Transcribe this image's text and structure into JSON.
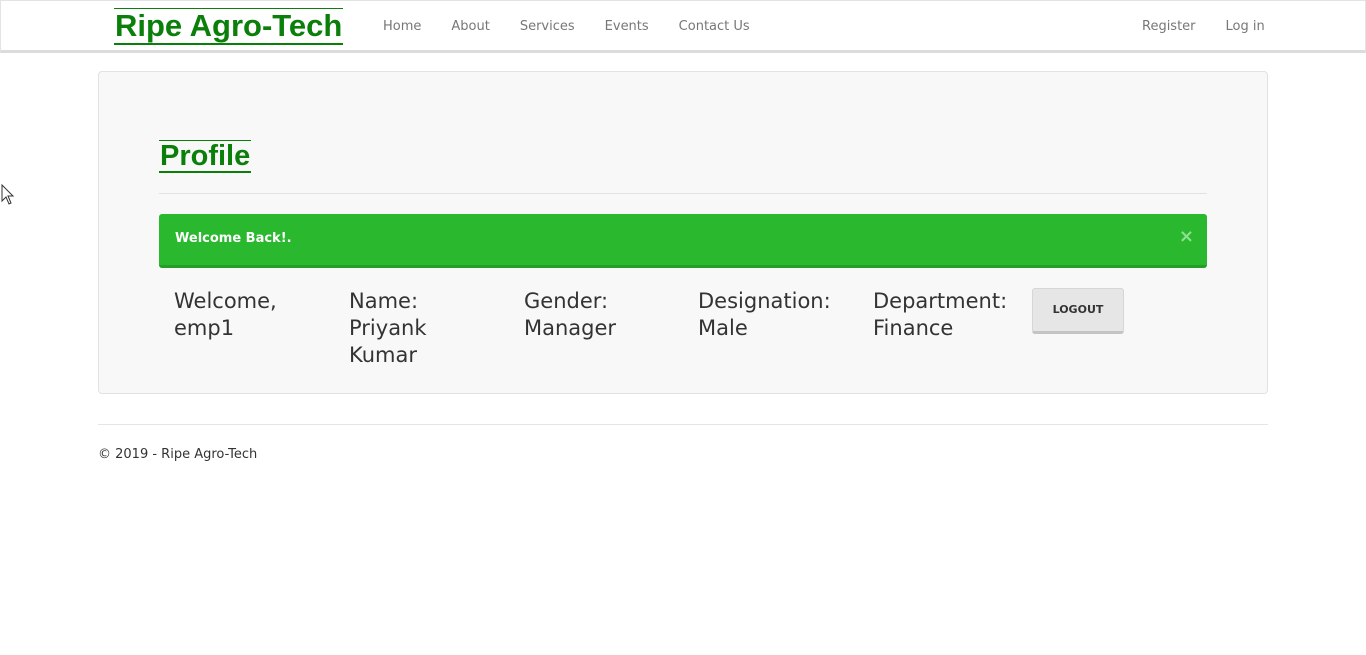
{
  "header": {
    "brand": "Ripe Agro-Tech",
    "nav": [
      {
        "label": "Home"
      },
      {
        "label": "About"
      },
      {
        "label": "Services"
      },
      {
        "label": "Events"
      },
      {
        "label": "Contact Us"
      }
    ],
    "auth": [
      {
        "label": "Register"
      },
      {
        "label": "Log in"
      }
    ]
  },
  "main": {
    "title": "Profile",
    "alert": {
      "message": "Welcome Back!.",
      "close": "×"
    },
    "profile": {
      "welcome": "Welcome, emp1",
      "name": "Name: Priyank Kumar",
      "gender": "Gender: Manager",
      "designation": "Designation: Male",
      "department": "Department: Finance"
    },
    "logout_label": "LOGOUT"
  },
  "footer": {
    "copyright": "© 2019 - Ripe Agro-Tech"
  },
  "colors": {
    "brand_green": "#0a7f0a",
    "alert_green": "#2ab82e"
  }
}
